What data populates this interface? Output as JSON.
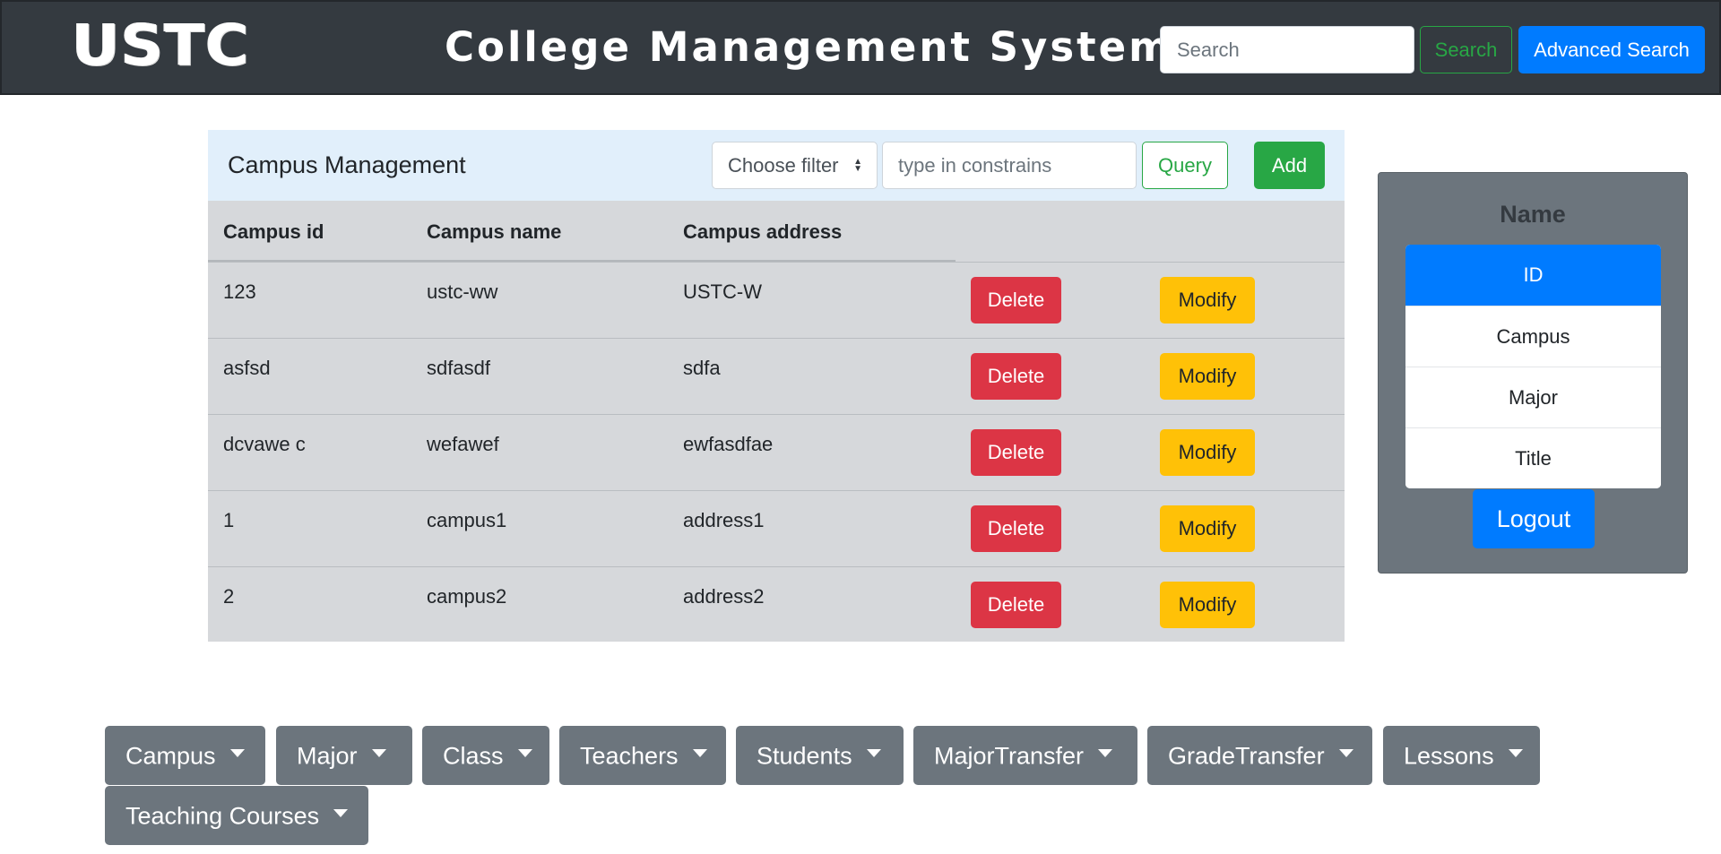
{
  "header": {
    "logo": "USTC",
    "title": "College Management System",
    "search_placeholder": "Search",
    "search_button": "Search",
    "advanced_search_button": "Advanced Search"
  },
  "panel": {
    "title": "Campus Management",
    "filter_select": "Choose filter",
    "constraint_placeholder": "type in constrains",
    "query_button": "Query",
    "add_button": "Add",
    "columns": [
      "Campus id",
      "Campus name",
      "Campus address"
    ],
    "rows": [
      {
        "id": "123",
        "name": "ustc-ww",
        "address": "USTC-W"
      },
      {
        "id": "asfsd",
        "name": "sdfasdf",
        "address": "sdfa"
      },
      {
        "id": "dcvawe c",
        "name": "wefawef",
        "address": "ewfasdfae"
      },
      {
        "id": "1",
        "name": "campus1",
        "address": "address1"
      },
      {
        "id": "2",
        "name": "campus2",
        "address": "address2"
      }
    ],
    "delete_label": "Delete",
    "modify_label": "Modify"
  },
  "sidebar": {
    "title": "Name",
    "items": [
      "ID",
      "Campus",
      "Major",
      "Title"
    ],
    "active_item": "ID",
    "logout_button": "Logout"
  },
  "menus": [
    "Campus",
    "Major",
    "Class",
    "Teachers",
    "Students",
    "MajorTransfer",
    "GradeTransfer",
    "Lessons",
    "Teaching Courses"
  ],
  "colors": {
    "navbar": "#343a40",
    "primary": "#007bff",
    "success": "#28a745",
    "danger": "#dc3545",
    "warning": "#ffc107",
    "secondary": "#6c757d",
    "panel_header": "#e1effb",
    "panel_body": "#d6d8db"
  }
}
